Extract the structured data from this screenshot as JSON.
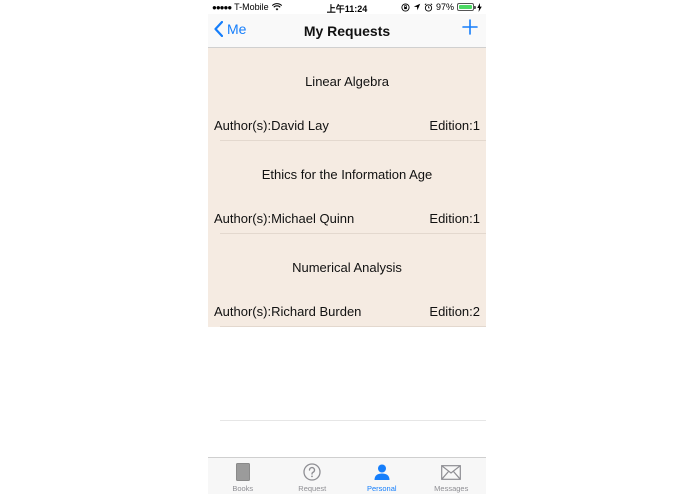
{
  "status_bar": {
    "signal": "●●●●●",
    "carrier": "T-Mobile",
    "time": "上午11:24",
    "battery_percent": "97%",
    "battery_level": 0.97
  },
  "nav": {
    "back_label": "Me",
    "title": "My Requests"
  },
  "requests": [
    {
      "title": "Linear Algebra",
      "author": "Author(s):David Lay",
      "edition": "Edition:1"
    },
    {
      "title": "Ethics for the Information Age",
      "author": "Author(s):Michael Quinn",
      "edition": "Edition:1"
    },
    {
      "title": "Numerical Analysis",
      "author": "Author(s):Richard Burden",
      "edition": "Edition:2"
    }
  ],
  "tabs": [
    {
      "label": "Books",
      "icon": "book-icon"
    },
    {
      "label": "Request",
      "icon": "question-circle-icon"
    },
    {
      "label": "Personal",
      "icon": "person-icon",
      "active": true
    },
    {
      "label": "Messages",
      "icon": "envelope-icon"
    }
  ],
  "colors": {
    "accent": "#157efb",
    "row_background": "#f5ebe2",
    "battery": "#4cd964"
  }
}
